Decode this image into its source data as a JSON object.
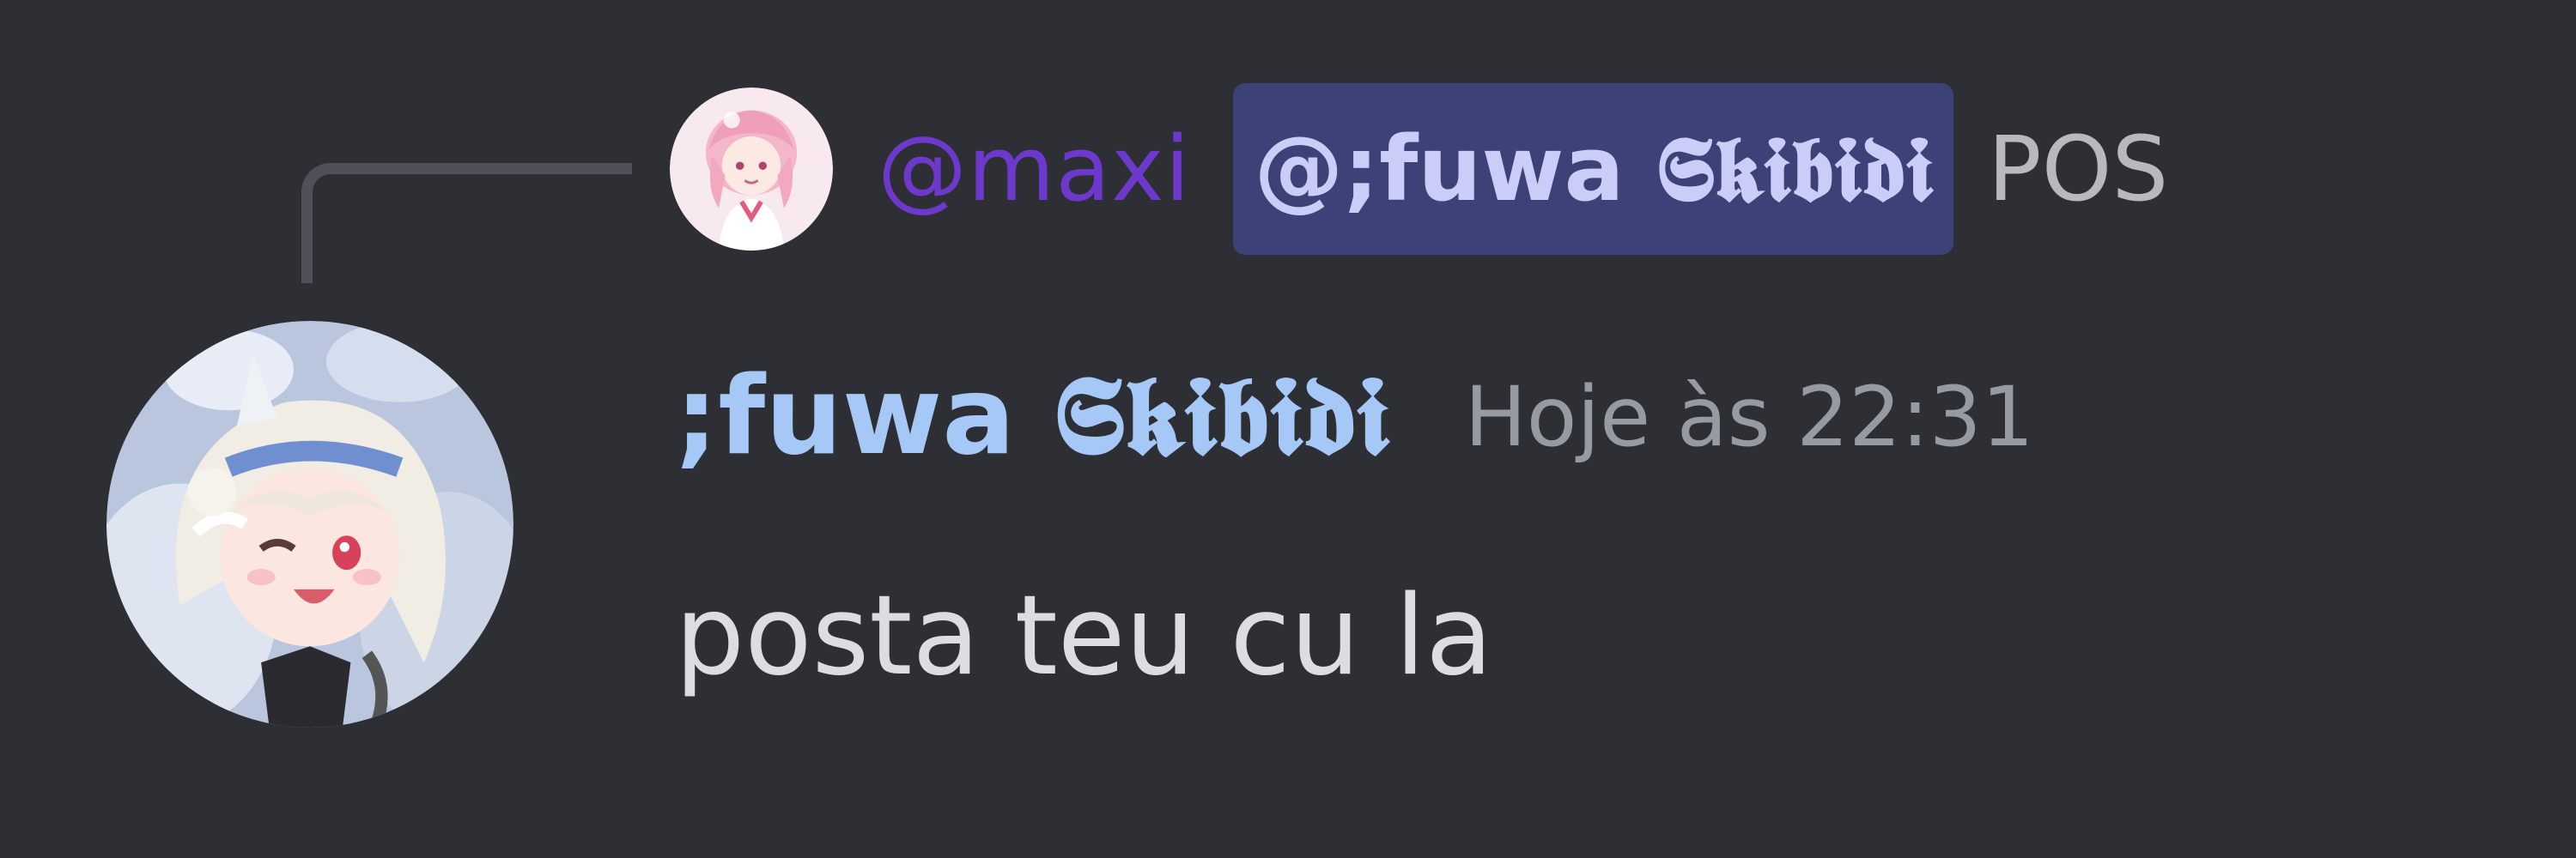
{
  "reply": {
    "author": "@maxi",
    "mention": "@;fuwa 𝕾𝖐𝖎𝖇𝖎𝖉𝖎",
    "snippet": "POS"
  },
  "message": {
    "author": ";fuwa 𝕾𝖐𝖎𝖇𝖎𝖉𝖎",
    "timestamp": "Hoje às 22:31",
    "text": "posta teu cu la"
  },
  "colors": {
    "background": "#2e2f35",
    "reply_author": "#6d39cc",
    "mention_bg": "#3c4278",
    "mention_text": "#c9cdf8",
    "author_name": "#a5c8f6",
    "timestamp": "#969aa2",
    "message_text": "#dcdde1"
  },
  "icons": {
    "reply_avatar": "avatar",
    "message_avatar": "avatar"
  }
}
